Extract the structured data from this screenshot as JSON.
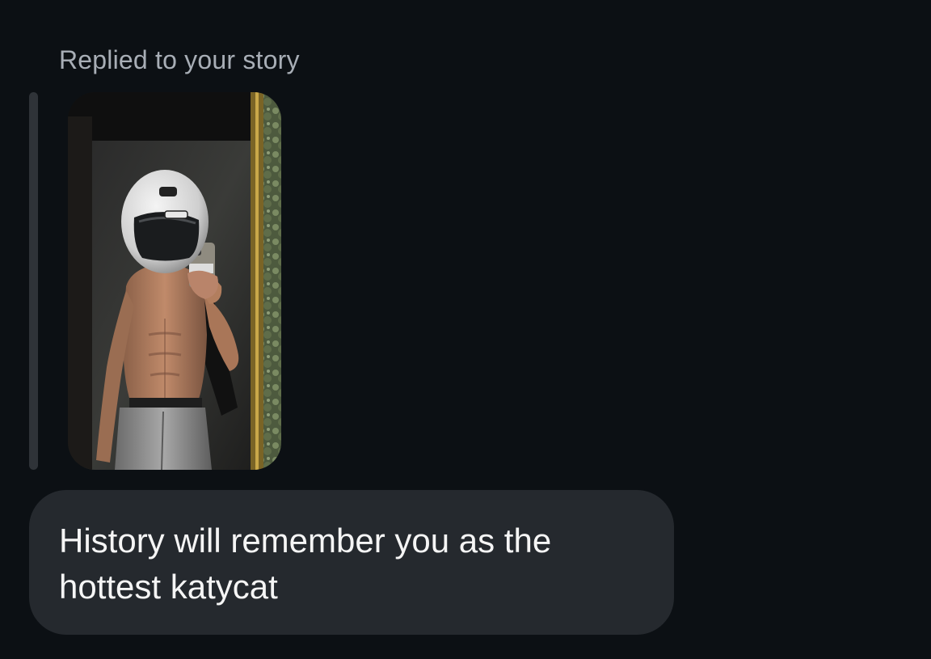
{
  "story_reply": {
    "caption": "Replied to your story",
    "thumbnail_icon": "story-photo-icon"
  },
  "message": {
    "text": "History will remember you as the\nhottest katycat"
  },
  "colors": {
    "background": "#0c1014",
    "bubble": "#25292e",
    "caption_text": "#a8aeb6",
    "message_text": "#f5f5f5",
    "reply_bar": "#2f3338"
  }
}
